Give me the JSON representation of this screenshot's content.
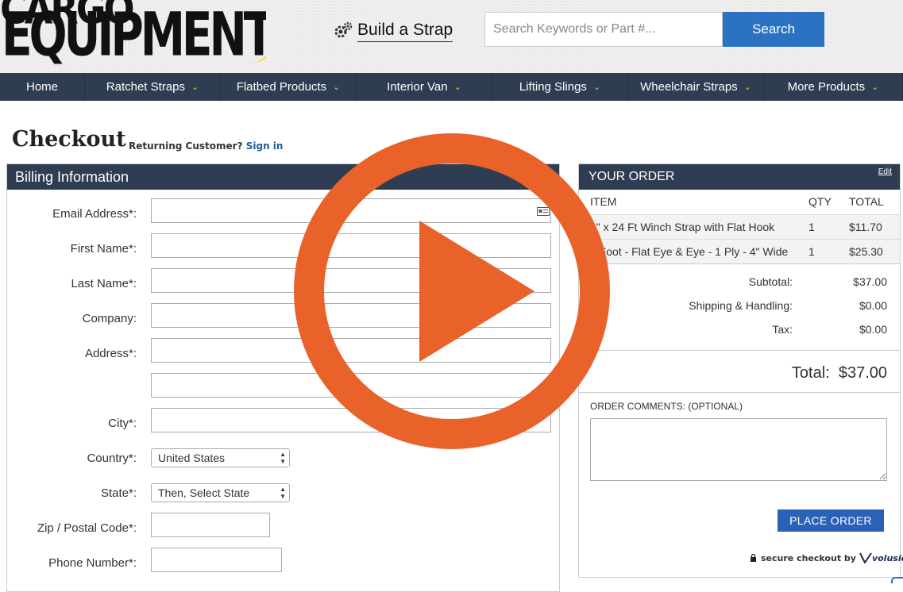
{
  "header": {
    "logo_top": "CARGO",
    "logo_main": "EQUIPMENT",
    "build_strap_label": "Build a Strap",
    "search_placeholder": "Search Keywords or Part #...",
    "search_button": "Search"
  },
  "nav": [
    {
      "label": "Home",
      "dropdown": false
    },
    {
      "label": "Ratchet Straps",
      "dropdown": true
    },
    {
      "label": "Flatbed Products",
      "dropdown": true
    },
    {
      "label": "Interior Van",
      "dropdown": true
    },
    {
      "label": "Lifting Slings",
      "dropdown": true
    },
    {
      "label": "Wheelchair Straps",
      "dropdown": true
    },
    {
      "label": "More Products",
      "dropdown": true
    }
  ],
  "checkout": {
    "title": "Checkout",
    "returning_text": "Returning Customer?",
    "signin_text": "Sign in"
  },
  "billing": {
    "heading": "Billing Information",
    "fields": {
      "email": "Email Address*:",
      "first_name": "First Name*:",
      "last_name": "Last Name*:",
      "company": "Company:",
      "address": "Address*:",
      "city": "City*:",
      "country": "Country*:",
      "state": "State*:",
      "zip": "Zip / Postal Code*:",
      "phone": "Phone Number*:"
    },
    "country_value": "United States",
    "state_value": "Then, Select State"
  },
  "order": {
    "heading": "YOUR ORDER",
    "edit_label": "Edit",
    "columns": {
      "item": "ITEM",
      "qty": "QTY",
      "total": "TOTAL"
    },
    "items": [
      {
        "name": "1\" x 24 Ft Winch Strap with Flat Hook",
        "qty": "1",
        "total": "$11.70"
      },
      {
        "name": "8 Foot - Flat Eye & Eye - 1 Ply - 4\" Wide",
        "qty": "1",
        "total": "$25.30"
      }
    ],
    "subtotal_label": "Subtotal:",
    "subtotal": "$37.00",
    "shipping_label": "Shipping & Handling:",
    "shipping": "$0.00",
    "tax_label": "Tax:",
    "tax": "$0.00",
    "total_label": "Total:",
    "total": "$37.00",
    "comments_label": "ORDER COMMENTS:  (OPTIONAL)",
    "place_order": "PLACE ORDER",
    "secure_text": "secure checkout by",
    "secure_brand": "volusion"
  },
  "colors": {
    "nav_bg": "#2e3d52",
    "accent_blue": "#2b72c2",
    "play_orange": "#e8622a"
  },
  "overlay": {
    "icon": "play-icon"
  }
}
